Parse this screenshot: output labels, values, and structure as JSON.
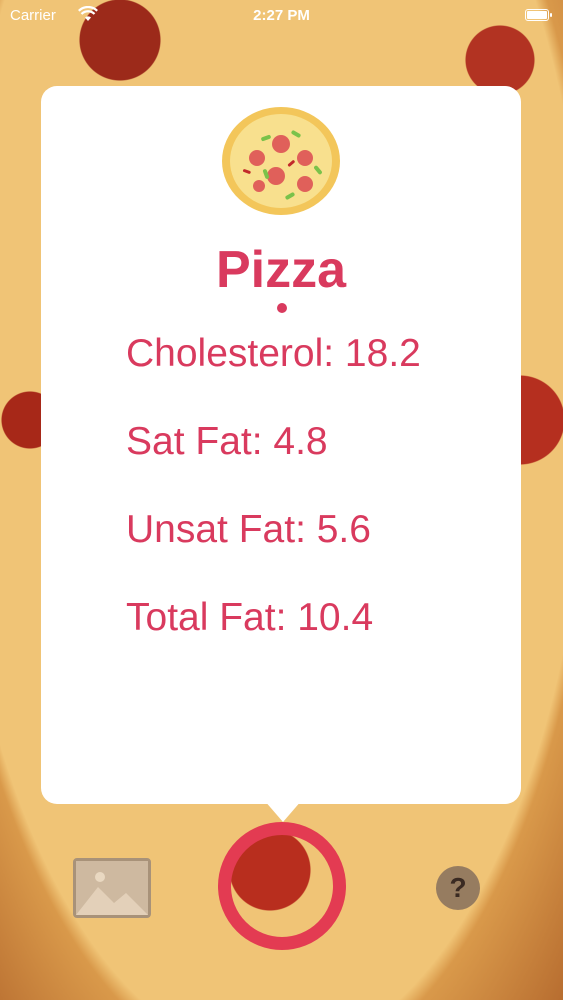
{
  "status_bar": {
    "carrier": "Carrier",
    "time": "2:27 PM",
    "wifi_icon": "wifi-icon",
    "battery_icon": "battery-icon"
  },
  "popover": {
    "icon": "pizza-icon",
    "title": "Pizza",
    "stats": [
      "Cholesterol: 18.2",
      "Sat Fat: 4.8",
      "Unsat Fat: 5.6",
      "Total Fat: 10.4"
    ]
  },
  "controls": {
    "gallery_icon": "photo-gallery-icon",
    "capture_icon": "capture-ring-icon",
    "help_label": "?"
  },
  "colors": {
    "accent": "#d93a5e",
    "capture_ring": "#e33b52",
    "card_bg": "#ffffff"
  }
}
